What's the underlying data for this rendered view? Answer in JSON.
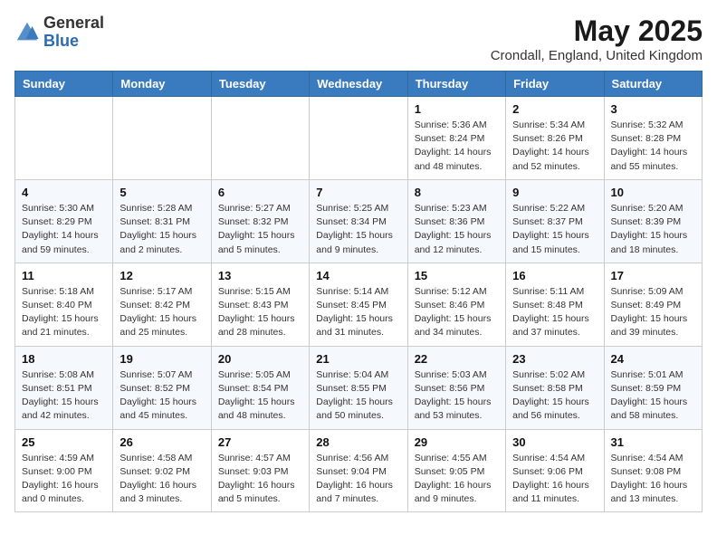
{
  "logo": {
    "general": "General",
    "blue": "Blue"
  },
  "title": "May 2025",
  "subtitle": "Crondall, England, United Kingdom",
  "days_of_week": [
    "Sunday",
    "Monday",
    "Tuesday",
    "Wednesday",
    "Thursday",
    "Friday",
    "Saturday"
  ],
  "weeks": [
    [
      {
        "day": "",
        "info": ""
      },
      {
        "day": "",
        "info": ""
      },
      {
        "day": "",
        "info": ""
      },
      {
        "day": "",
        "info": ""
      },
      {
        "day": "1",
        "info": "Sunrise: 5:36 AM\nSunset: 8:24 PM\nDaylight: 14 hours\nand 48 minutes."
      },
      {
        "day": "2",
        "info": "Sunrise: 5:34 AM\nSunset: 8:26 PM\nDaylight: 14 hours\nand 52 minutes."
      },
      {
        "day": "3",
        "info": "Sunrise: 5:32 AM\nSunset: 8:28 PM\nDaylight: 14 hours\nand 55 minutes."
      }
    ],
    [
      {
        "day": "4",
        "info": "Sunrise: 5:30 AM\nSunset: 8:29 PM\nDaylight: 14 hours\nand 59 minutes."
      },
      {
        "day": "5",
        "info": "Sunrise: 5:28 AM\nSunset: 8:31 PM\nDaylight: 15 hours\nand 2 minutes."
      },
      {
        "day": "6",
        "info": "Sunrise: 5:27 AM\nSunset: 8:32 PM\nDaylight: 15 hours\nand 5 minutes."
      },
      {
        "day": "7",
        "info": "Sunrise: 5:25 AM\nSunset: 8:34 PM\nDaylight: 15 hours\nand 9 minutes."
      },
      {
        "day": "8",
        "info": "Sunrise: 5:23 AM\nSunset: 8:36 PM\nDaylight: 15 hours\nand 12 minutes."
      },
      {
        "day": "9",
        "info": "Sunrise: 5:22 AM\nSunset: 8:37 PM\nDaylight: 15 hours\nand 15 minutes."
      },
      {
        "day": "10",
        "info": "Sunrise: 5:20 AM\nSunset: 8:39 PM\nDaylight: 15 hours\nand 18 minutes."
      }
    ],
    [
      {
        "day": "11",
        "info": "Sunrise: 5:18 AM\nSunset: 8:40 PM\nDaylight: 15 hours\nand 21 minutes."
      },
      {
        "day": "12",
        "info": "Sunrise: 5:17 AM\nSunset: 8:42 PM\nDaylight: 15 hours\nand 25 minutes."
      },
      {
        "day": "13",
        "info": "Sunrise: 5:15 AM\nSunset: 8:43 PM\nDaylight: 15 hours\nand 28 minutes."
      },
      {
        "day": "14",
        "info": "Sunrise: 5:14 AM\nSunset: 8:45 PM\nDaylight: 15 hours\nand 31 minutes."
      },
      {
        "day": "15",
        "info": "Sunrise: 5:12 AM\nSunset: 8:46 PM\nDaylight: 15 hours\nand 34 minutes."
      },
      {
        "day": "16",
        "info": "Sunrise: 5:11 AM\nSunset: 8:48 PM\nDaylight: 15 hours\nand 37 minutes."
      },
      {
        "day": "17",
        "info": "Sunrise: 5:09 AM\nSunset: 8:49 PM\nDaylight: 15 hours\nand 39 minutes."
      }
    ],
    [
      {
        "day": "18",
        "info": "Sunrise: 5:08 AM\nSunset: 8:51 PM\nDaylight: 15 hours\nand 42 minutes."
      },
      {
        "day": "19",
        "info": "Sunrise: 5:07 AM\nSunset: 8:52 PM\nDaylight: 15 hours\nand 45 minutes."
      },
      {
        "day": "20",
        "info": "Sunrise: 5:05 AM\nSunset: 8:54 PM\nDaylight: 15 hours\nand 48 minutes."
      },
      {
        "day": "21",
        "info": "Sunrise: 5:04 AM\nSunset: 8:55 PM\nDaylight: 15 hours\nand 50 minutes."
      },
      {
        "day": "22",
        "info": "Sunrise: 5:03 AM\nSunset: 8:56 PM\nDaylight: 15 hours\nand 53 minutes."
      },
      {
        "day": "23",
        "info": "Sunrise: 5:02 AM\nSunset: 8:58 PM\nDaylight: 15 hours\nand 56 minutes."
      },
      {
        "day": "24",
        "info": "Sunrise: 5:01 AM\nSunset: 8:59 PM\nDaylight: 15 hours\nand 58 minutes."
      }
    ],
    [
      {
        "day": "25",
        "info": "Sunrise: 4:59 AM\nSunset: 9:00 PM\nDaylight: 16 hours\nand 0 minutes."
      },
      {
        "day": "26",
        "info": "Sunrise: 4:58 AM\nSunset: 9:02 PM\nDaylight: 16 hours\nand 3 minutes."
      },
      {
        "day": "27",
        "info": "Sunrise: 4:57 AM\nSunset: 9:03 PM\nDaylight: 16 hours\nand 5 minutes."
      },
      {
        "day": "28",
        "info": "Sunrise: 4:56 AM\nSunset: 9:04 PM\nDaylight: 16 hours\nand 7 minutes."
      },
      {
        "day": "29",
        "info": "Sunrise: 4:55 AM\nSunset: 9:05 PM\nDaylight: 16 hours\nand 9 minutes."
      },
      {
        "day": "30",
        "info": "Sunrise: 4:54 AM\nSunset: 9:06 PM\nDaylight: 16 hours\nand 11 minutes."
      },
      {
        "day": "31",
        "info": "Sunrise: 4:54 AM\nSunset: 9:08 PM\nDaylight: 16 hours\nand 13 minutes."
      }
    ]
  ]
}
